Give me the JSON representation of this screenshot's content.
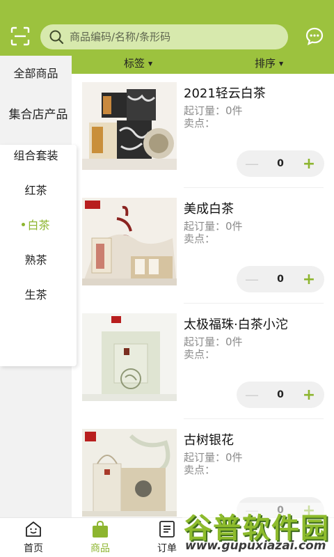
{
  "header": {
    "search_placeholder": "商品编码/名称/条形码",
    "scan_icon": "scan-icon",
    "message_icon": "chat-bubble-icon",
    "accent": "#9cc23e"
  },
  "sidebar": {
    "items": [
      {
        "label": "全部商品"
      },
      {
        "label": "集合店产品"
      },
      {
        "label": "组合套装"
      },
      {
        "label": "红茶"
      },
      {
        "label": "白茶",
        "active": true
      },
      {
        "label": "熟茶"
      },
      {
        "label": "生茶"
      }
    ]
  },
  "sortbar": {
    "tag_label": "标签",
    "sort_label": "排序"
  },
  "products": [
    {
      "name": "2021轻云白茶",
      "min_order": "起订量：0件",
      "selling_point": "卖点：",
      "qty": "0"
    },
    {
      "name": "美成白茶",
      "min_order": "起订量：0件",
      "selling_point": "卖点：",
      "qty": "0"
    },
    {
      "name": "太极福珠·白茶小沱",
      "min_order": "起订量：0件",
      "selling_point": "卖点：",
      "qty": "0"
    },
    {
      "name": "古树银花",
      "min_order": "起订量：0件",
      "selling_point": "卖点：",
      "qty": "0"
    }
  ],
  "tabbar": {
    "tabs": [
      {
        "label": "首页",
        "icon": "home-smile-icon"
      },
      {
        "label": "商品",
        "icon": "shopping-bag-icon",
        "active": true
      },
      {
        "label": "订单",
        "icon": "order-list-icon"
      }
    ]
  },
  "watermark": {
    "title": "谷普软件园",
    "url": "www.gupuxiazai.com"
  }
}
